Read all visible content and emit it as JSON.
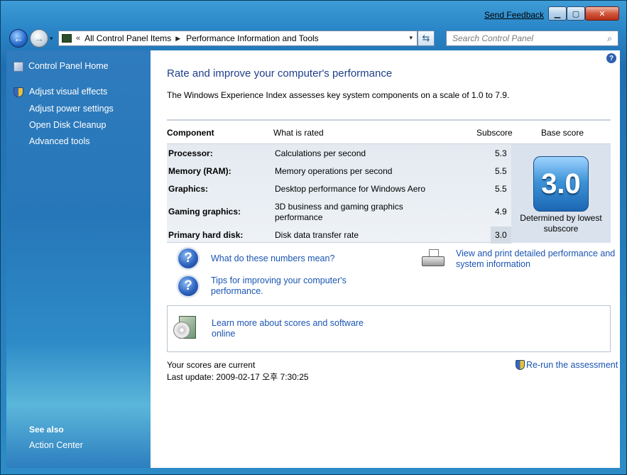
{
  "titlebar": {
    "send_feedback": "Send Feedback",
    "min_glyph": "▁",
    "max_glyph": "▢",
    "close_glyph": "✕"
  },
  "nav": {
    "back_glyph": "←",
    "forward_glyph": "→",
    "recent_glyph": "▾",
    "address": {
      "chevron": "«",
      "segments": [
        "All Control Panel Items",
        "Performance Information and Tools"
      ],
      "separator": "▶",
      "dropdown_glyph": "▾"
    },
    "refresh_glyph": "⇆",
    "search": {
      "placeholder": "Search Control Panel",
      "icon_glyph": "⌕"
    }
  },
  "sidebar": {
    "home": "Control Panel Home",
    "tasks": [
      {
        "label": "Adjust visual effects",
        "icon": "shield-icon"
      },
      {
        "label": "Adjust power settings"
      },
      {
        "label": "Open Disk Cleanup"
      },
      {
        "label": "Advanced tools"
      }
    ],
    "see_also": {
      "title": "See also",
      "items": [
        "Action Center"
      ]
    }
  },
  "main": {
    "help_glyph": "?",
    "title": "Rate and improve your computer's performance",
    "intro": "The Windows Experience Index assesses key system components on a scale of 1.0 to 7.9.",
    "table": {
      "headers": {
        "component": "Component",
        "what": "What is rated",
        "subscore": "Subscore",
        "base": "Base score"
      },
      "rows": [
        {
          "component": "Processor:",
          "what": "Calculations per second",
          "subscore": "5.3"
        },
        {
          "component": "Memory (RAM):",
          "what": "Memory operations per second",
          "subscore": "5.5"
        },
        {
          "component": "Graphics:",
          "what": "Desktop performance for Windows Aero",
          "subscore": "5.5"
        },
        {
          "component": "Gaming graphics:",
          "what": "3D business and gaming graphics performance",
          "subscore": "4.9"
        },
        {
          "component": "Primary hard disk:",
          "what": "Disk data transfer rate",
          "subscore": "3.0"
        }
      ],
      "base_score": "3.0",
      "base_caption": "Determined by lowest subscore"
    },
    "links": {
      "what_mean": "What do these numbers mean?",
      "tips": "Tips for improving your computer's performance.",
      "view_print": "View and print detailed performance and system information",
      "learn_more": "Learn more about scores and software online",
      "q_glyph": "?"
    },
    "status": {
      "current": "Your scores are current",
      "last_update": "Last update: 2009-02-17 오후 7:30:25",
      "rerun": "Re-run the assessment"
    }
  },
  "colors": {
    "link": "#1a55b3",
    "title": "#1f3e8a",
    "sidebar": "#2677b9"
  }
}
